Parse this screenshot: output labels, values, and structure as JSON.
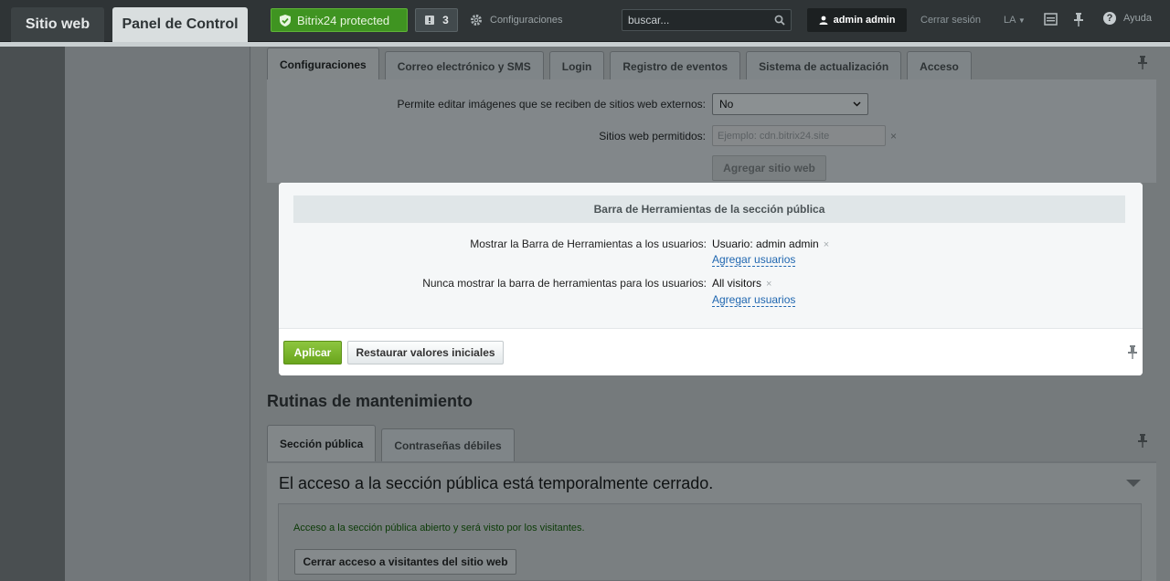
{
  "topbar": {
    "site_tab": "Sitio web",
    "panel_tab": "Panel de Control",
    "protected_label": "Bitrix24 protected",
    "notifications_count": "3",
    "settings_label": "Configuraciones",
    "search_placeholder": "buscar...",
    "user_label": "admin admin",
    "logout_label": "Cerrar sesión",
    "lang_label": "LA",
    "help_label": "Ayuda"
  },
  "settings_tabs": [
    "Configuraciones",
    "Correo electrónico y SMS",
    "Login",
    "Registro de eventos",
    "Sistema de actualización",
    "Acceso"
  ],
  "image_settings": {
    "allow_edit_label": "Permite editar imágenes que se reciben de sitios web externos:",
    "allow_edit_value": "No",
    "allowed_sites_label": "Sitios web permitidos:",
    "allowed_sites_placeholder": "Ejemplo: cdn.bitrix24.site",
    "add_site_button": "Agregar sitio web"
  },
  "toolbar_section": {
    "title": "Barra de Herramientas de la sección pública",
    "show_label": "Mostrar la Barra de Herramientas a los usuarios:",
    "show_value": "Usuario: admin admin",
    "add_users_1": "Agregar usuarios",
    "never_label": "Nunca mostrar la barra de herramientas para los usuarios:",
    "never_value": "All visitors",
    "add_users_2": "Agregar usuarios",
    "apply_button": "Aplicar",
    "reset_button": "Restaurar valores iniciales"
  },
  "maintenance": {
    "heading": "Rutinas de mantenimiento",
    "tabs": [
      "Sección pública",
      "Contraseñas débiles"
    ],
    "closed_title": "El acceso a la sección pública está temporalmente cerrado.",
    "status_message": "Acceso a la sección pública abierto y será visto por los visitantes.",
    "close_button": "Cerrar acceso a visitantes del sitio web"
  }
}
